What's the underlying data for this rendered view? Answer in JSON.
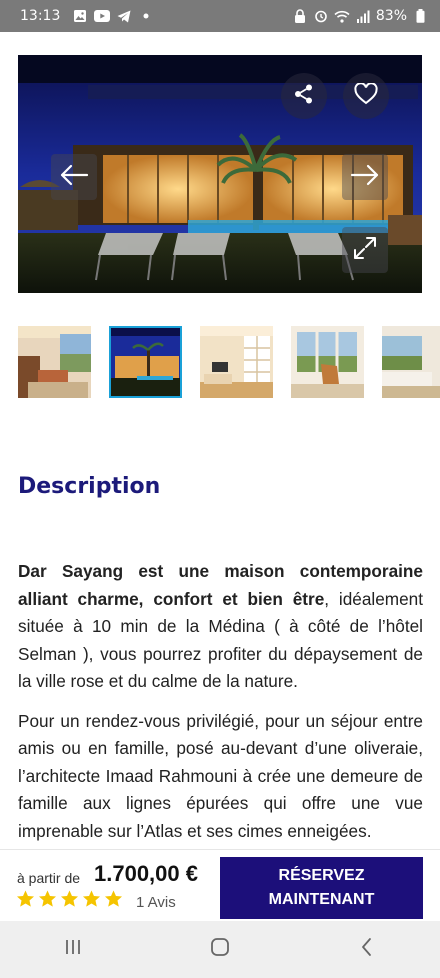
{
  "status_bar": {
    "time": "13:13",
    "battery": "83%",
    "left_icons": [
      "image-icon",
      "youtube-icon",
      "telegram-icon",
      "dot-icon"
    ],
    "right_icons": [
      "lock-icon",
      "alarm-icon",
      "wifi-icon",
      "signal-icon",
      "battery-icon"
    ]
  },
  "gallery": {
    "thumbnail_count": 5,
    "active_thumbnail": 2
  },
  "description": {
    "title": "Description",
    "para1_bold": "Dar Sayang est une maison contemporaine alliant charme, confort et bien être",
    "para1_rest": ", idéalement située à 10 min de la Médina ( à côté de l’hôtel Selman ), vous pourrez profiter du dépaysement de la ville rose et du calme de la nature.",
    "para2": "Pour un rendez-vous privilégié, pour un séjour entre amis ou en famille, posé au-devant d’une oliveraie, l’architecte Imaad Rahmouni à crée une demeure de famille aux lignes épurées qui offre une vue imprenable sur l’Atlas et ses cimes enneigées."
  },
  "booking": {
    "price_prefix": "à partir de",
    "price": "1.700,00 €",
    "rating": 5,
    "reviews": "1 Avis",
    "button_label": "RÉSERVEZ MAINTENANT"
  },
  "colors": {
    "accent": "#1c0f7a",
    "title": "#1c1a7a",
    "star": "#f5c400",
    "active_thumb_border": "#1aa1d8"
  }
}
